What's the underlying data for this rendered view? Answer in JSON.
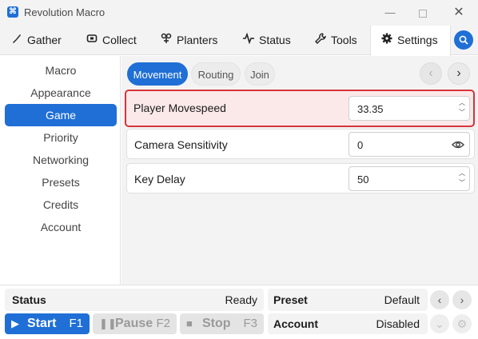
{
  "window": {
    "title": "Revolution Macro",
    "icon_glyph": "⌘",
    "minimize": "—",
    "close": "✕"
  },
  "tabs": [
    {
      "label": "Gather",
      "icon": "brush-icon"
    },
    {
      "label": "Collect",
      "icon": "collect-icon"
    },
    {
      "label": "Planters",
      "icon": "plant-icon"
    },
    {
      "label": "Status",
      "icon": "pulse-icon"
    },
    {
      "label": "Tools",
      "icon": "wrench-icon"
    },
    {
      "label": "Settings",
      "icon": "gear-icon",
      "active": true
    }
  ],
  "sidebar": {
    "items": [
      {
        "label": "Macro"
      },
      {
        "label": "Appearance"
      },
      {
        "label": "Game",
        "active": true
      },
      {
        "label": "Priority"
      },
      {
        "label": "Networking"
      },
      {
        "label": "Presets"
      },
      {
        "label": "Credits"
      },
      {
        "label": "Account"
      }
    ]
  },
  "subtabs": [
    {
      "label": "Movement",
      "active": true
    },
    {
      "label": "Routing"
    },
    {
      "label": "Join"
    }
  ],
  "settings": [
    {
      "label": "Player Movespeed",
      "value": "33.35",
      "control": "stepper",
      "highlighted": true
    },
    {
      "label": "Camera Sensitivity",
      "value": "0",
      "control": "eye"
    },
    {
      "label": "Key Delay",
      "value": "50",
      "control": "stepper"
    }
  ],
  "footer": {
    "status_label": "Status",
    "status_value": "Ready",
    "preset_label": "Preset",
    "preset_value": "Default",
    "account_label": "Account",
    "account_value": "Disabled",
    "start_label": "Start",
    "start_key": "F1",
    "pause_label": "Pause",
    "pause_key": "F2",
    "stop_label": "Stop",
    "stop_key": "F3"
  },
  "colors": {
    "accent": "#1f6fd6",
    "highlight_border": "#d6343a",
    "highlight_bg": "#fbe9e9"
  }
}
